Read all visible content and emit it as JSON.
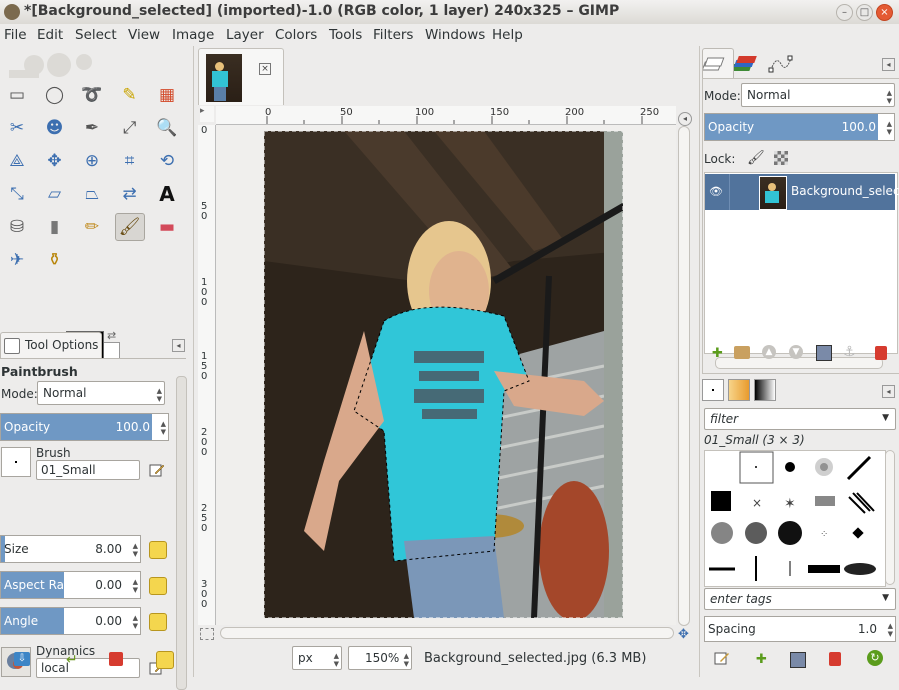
{
  "window": {
    "title": "*[Background_selected] (imported)-1.0 (RGB color, 1 layer) 240x325 – GIMP",
    "controls": [
      "–",
      "□",
      "×"
    ]
  },
  "menubar": [
    "File",
    "Edit",
    "Select",
    "View",
    "Image",
    "Layer",
    "Colors",
    "Tools",
    "Filters",
    "Windows",
    "Help"
  ],
  "toolbox": {
    "tools": [
      "rect-select",
      "ellipse-select",
      "free-select",
      "fuzzy-select",
      "color-select",
      "scissors-select",
      "foreground-select",
      "paths",
      "color-picker",
      "zoom",
      "measure",
      "move",
      "align",
      "crop",
      "rotate",
      "scale",
      "shear",
      "perspective",
      "flip",
      "text",
      "bucket-fill",
      "blend",
      "pencil",
      "paintbrush",
      "eraser",
      "airbrush",
      "clone"
    ],
    "active_tool": "paintbrush",
    "fg_color": "#000000",
    "bg_color": "#ffffff"
  },
  "tool_options": {
    "tab_label": "Tool Options",
    "tool_name": "Paintbrush",
    "mode_label": "Mode:",
    "mode_value": "Normal",
    "opacity_label": "Opacity",
    "opacity_value": "100.0",
    "brush_label": "Brush",
    "brush_value": "01_Small",
    "size_label": "Size",
    "size_value": "8.00",
    "aspect_label": "Aspect Ratio",
    "aspect_value": "0.00",
    "angle_label": "Angle",
    "angle_value": "0.00",
    "dynamics_label": "Dynamics",
    "dynamics_value": "local"
  },
  "canvas": {
    "ruler_h": [
      "0",
      "50",
      "100",
      "150",
      "200",
      "250"
    ],
    "ruler_v": [
      [
        "0"
      ],
      [
        "5",
        "0"
      ],
      [
        "1",
        "0",
        "0"
      ],
      [
        "1",
        "5",
        "0"
      ],
      [
        "2",
        "0",
        "0"
      ],
      [
        "2",
        "5",
        "0"
      ],
      [
        "3",
        "0",
        "0"
      ]
    ],
    "unit": "px",
    "zoom": "150%",
    "status": "Background_selected.jpg (6.3 MB)"
  },
  "layers": {
    "mode_label": "Mode:",
    "mode_value": "Normal",
    "opacity_label": "Opacity",
    "opacity_value": "100.0",
    "lock_label": "Lock:",
    "layer_name": "Background_selected"
  },
  "brushes": {
    "filter_placeholder": "filter",
    "selected_brush": "01_Small (3 × 3)",
    "tags_placeholder": "enter tags",
    "spacing_label": "Spacing",
    "spacing_value": "1.0"
  }
}
